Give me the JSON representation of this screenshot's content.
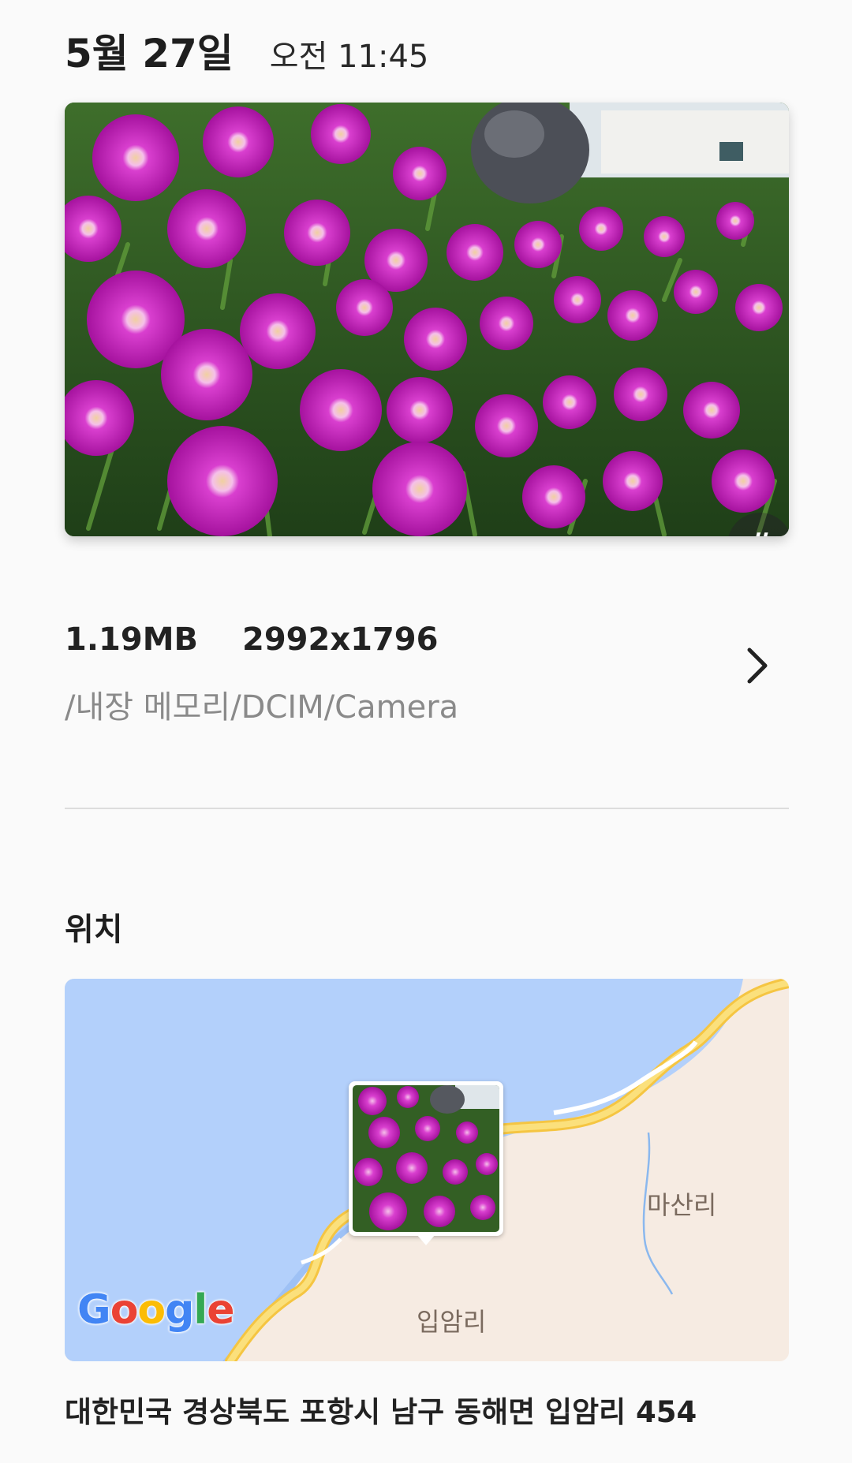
{
  "header": {
    "date": "5월 27일",
    "time": "오전 11:45"
  },
  "photo": {
    "tag_icon_glyph": "#",
    "flower_color": "#c21fb6",
    "foliage_color": "#3f7a2a"
  },
  "file_info": {
    "size": "1.19MB",
    "resolution": "2992x1796",
    "path": "/내장 메모리/DCIM/Camera"
  },
  "location": {
    "section_title": "위치",
    "map_labels": {
      "masanri": "마산리",
      "ibamri": "입암리"
    },
    "google_logo": "Google",
    "address": "대한민국 경상북도 포항시 남구 동해면 입암리 454",
    "sea_color": "#b3d0fb",
    "land_color": "#f6ebe2",
    "road_color": "#f8d35a"
  }
}
